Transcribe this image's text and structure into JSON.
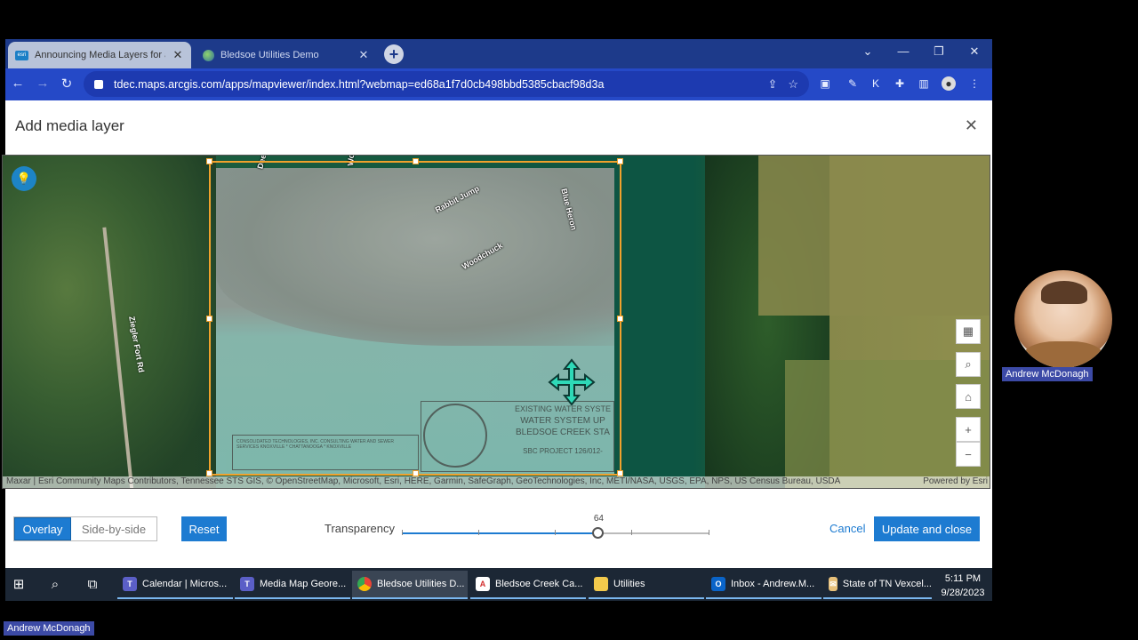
{
  "browser": {
    "tabs": [
      {
        "title": "Announcing Media Layers for ar",
        "active": true
      },
      {
        "title": "Bledsoe Utilities Demo",
        "active": false
      }
    ],
    "url": "tdec.maps.arcgis.com/apps/mapviewer/index.html?webmap=ed68a1f7d0cb498bbd5385cbacf98d3a"
  },
  "dialog": {
    "title": "Add media layer"
  },
  "map": {
    "road_label": "Ziegler Fort Rd",
    "street_labels": [
      "Deer R",
      "Woodc",
      "Rabbit Jump",
      "Blue Heron",
      "Woodchuck"
    ],
    "title_block": {
      "line1": "EXISTING WATER SYSTE",
      "line2": "WATER SYSTEM UP",
      "line3": "BLEDSOE CREEK STA",
      "line4": "SBC PROJECT 126/012-"
    },
    "contractor": "CONSOLIDATED TECHNOLOGIES, INC. CONSULTING WATER AND SEWER SERVICES KNOXVILLE * CHATTANOOGA * KNOXVILLE",
    "attribution": "Maxar | Esri Community Maps Contributors, Tennessee STS GIS, © OpenStreetMap, Microsoft, Esri, HERE, Garmin, SafeGraph, GeoTechnologies, Inc, METI/NASA, USGS, EPA, NPS, US Census Bureau, USDA",
    "powered_by": "Powered by Esri"
  },
  "controls": {
    "mode_overlay": "Overlay",
    "mode_side_by_side": "Side-by-side",
    "selected_mode": "Overlay",
    "reset": "Reset",
    "transparency_label": "Transparency",
    "transparency_value": "64",
    "transparency_fraction": 0.64,
    "cancel": "Cancel",
    "update": "Update and close"
  },
  "taskbar": {
    "apps": [
      {
        "label": "Calendar | Micros..."
      },
      {
        "label": "Media Map Geore..."
      },
      {
        "label": "Bledsoe Utilities D..."
      },
      {
        "label": "Bledsoe Creek Ca..."
      },
      {
        "label": "Utilities"
      },
      {
        "label": "Inbox - Andrew.M..."
      },
      {
        "label": "State of TN Vexcel..."
      }
    ],
    "time": "5:11 PM",
    "date": "9/28/2023"
  },
  "webcam": {
    "name": "Andrew McDonagh",
    "bottom_name": "Andrew McDonagh"
  },
  "colors": {
    "accent": "#1d7bd1",
    "frame": "#f0a12c",
    "tab_bar": "#1d3a8a",
    "toolbar": "#2549c7"
  }
}
